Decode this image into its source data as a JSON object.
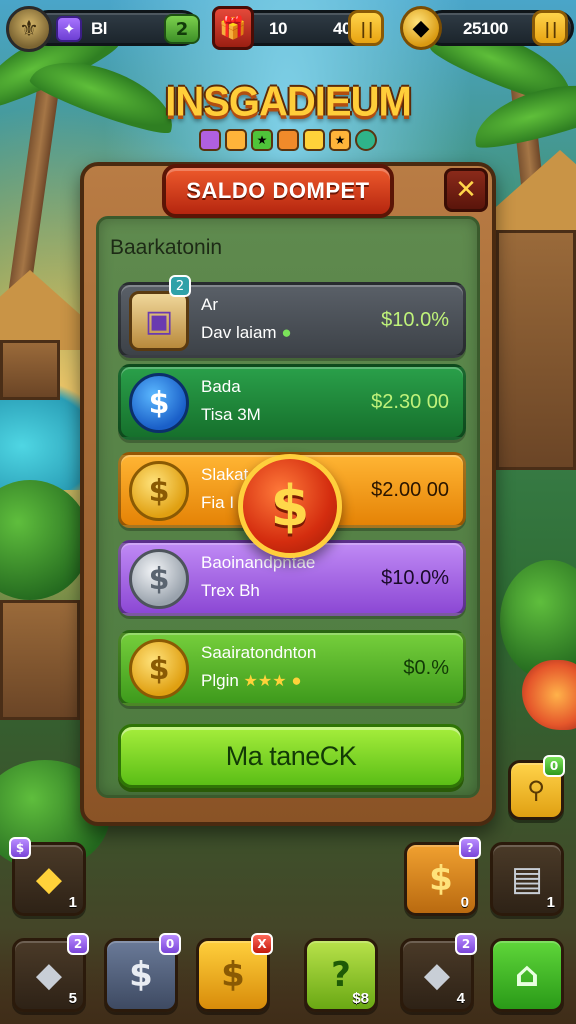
{
  "topbar": {
    "avatar_icon": "crest-icon",
    "gem_icon": "fleur-icon",
    "player_stat": "Bl",
    "level": "2",
    "resource_1": "10",
    "resource_1_tail": "40",
    "resource_2": "25100",
    "resource_icon_1": "chest-icon",
    "resource_icon_2": "gold-bar-icon"
  },
  "logo": {
    "title": "INSGADIEUM"
  },
  "panel": {
    "title": "SALDO DOMPET",
    "close_label": "✕",
    "section_label": "Baarkatonin",
    "action_label": "Ma taneCK",
    "rows": [
      {
        "name": "Ar",
        "sub": "Dav laiam",
        "amount": "$10.0%",
        "badge": "2",
        "color": "#4a4f55",
        "icon": "crate-icon",
        "amount_color": "#bff27a"
      },
      {
        "name": "Bada",
        "sub": "Tisa 3M",
        "amount": "$2.30 00",
        "color": "#1e8a3a",
        "icon": "blue-coin-icon",
        "amount_color": "#bff27a"
      },
      {
        "name": "Slakat",
        "sub": "Fia I",
        "amount": "$2.00 00",
        "color": "#f39a16",
        "icon": "gold-coin-icon",
        "amount_color": "#2a1500"
      },
      {
        "name": "Baoinandpntae",
        "sub": "Trex Bh",
        "amount": "$10.0%",
        "color": "#a65fe0",
        "icon": "silver-coin-icon",
        "amount_color": "#1a0a2a"
      },
      {
        "name": "Saairatondnton",
        "sub": "Plgin",
        "amount": "$0.%",
        "color": "#5cb32b",
        "icon": "gold-coins-icon",
        "amount_color": "#123a06"
      }
    ]
  },
  "bottom": {
    "left_slot": {
      "count": "1",
      "badge": "$"
    },
    "right_slots": [
      {
        "count": "0",
        "badge": "?"
      },
      {
        "count": "1"
      }
    ],
    "hotbar": [
      {
        "count": "5",
        "badge": "2"
      },
      {
        "badge": "0"
      },
      {
        "badge": "X"
      },
      {
        "count": "$8"
      },
      {
        "count": "4",
        "badge": "2"
      },
      {}
    ],
    "side_button_badge": "0"
  },
  "colors": {
    "panel_wood": "#8a5326",
    "ribbon_red": "#d23a18",
    "action_green": "#7ed62a",
    "coin_gold": "#ffcf3c"
  }
}
